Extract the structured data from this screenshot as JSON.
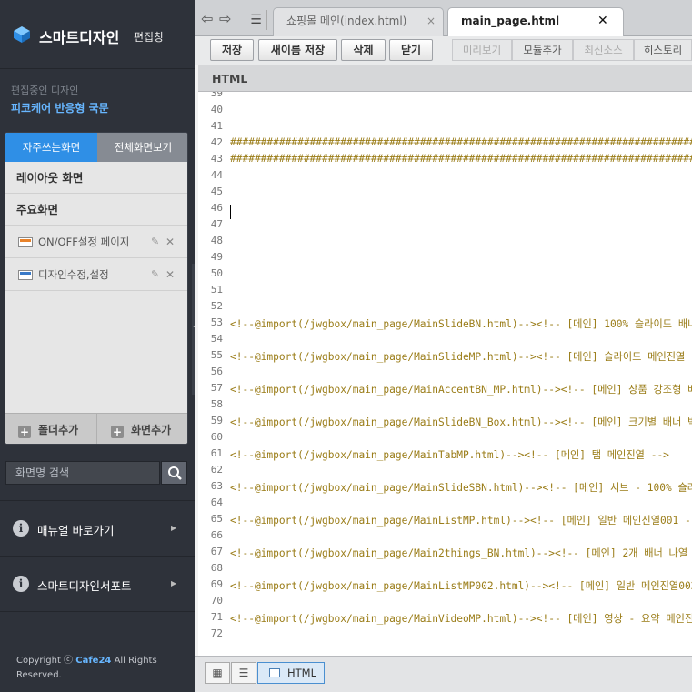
{
  "brand": {
    "title": "스마트디자인",
    "subtitle": "편집창"
  },
  "current": {
    "label": "편집중인 디자인",
    "name": "피코케어 반응형 국문"
  },
  "panel": {
    "tabs": [
      "자주쓰는화면",
      "전체화면보기"
    ],
    "sections": [
      "레이아웃 화면",
      "주요화면"
    ],
    "items": [
      {
        "label": "ON/OFF설정 페이지",
        "icon": "page-on-icon"
      },
      {
        "label": "디자인수정,설정",
        "icon": "page-design-icon"
      }
    ],
    "footer": {
      "add_folder": "폴더추가",
      "add_screen": "화면추가"
    }
  },
  "search": {
    "placeholder": "화면명 검색"
  },
  "links": [
    {
      "label": "매뉴얼 바로가기"
    },
    {
      "label": "스마트디자인서포트"
    }
  ],
  "copyright": {
    "prefix": "Copyright ⓒ",
    "brand": "Cafe24",
    "suffix": "All Rights Reserved."
  },
  "file_tabs": [
    {
      "label": "쇼핑몰 메인(index.html)",
      "close": "×"
    },
    {
      "label": "main_page.html",
      "close": "✕"
    }
  ],
  "toolbar": {
    "save": "저장",
    "save_as": "새이름 저장",
    "delete": "삭제",
    "close": "닫기",
    "preview": "미리보기",
    "add_module": "모듈추가",
    "latest_source": "최신소스",
    "history": "히스토리"
  },
  "editor": {
    "language": "HTML"
  },
  "code_lines": [
    {
      "n": "39",
      "text": ""
    },
    {
      "n": "40",
      "text": ""
    },
    {
      "n": "41",
      "text": ""
    },
    {
      "n": "42",
      "text": "##################################################################################"
    },
    {
      "n": "43",
      "text": "##################################################################################"
    },
    {
      "n": "44",
      "text": ""
    },
    {
      "n": "45",
      "text": ""
    },
    {
      "n": "46",
      "text": ""
    },
    {
      "n": "47",
      "text": ""
    },
    {
      "n": "48",
      "text": ""
    },
    {
      "n": "49",
      "text": ""
    },
    {
      "n": "50",
      "text": ""
    },
    {
      "n": "51",
      "text": ""
    },
    {
      "n": "52",
      "text": ""
    },
    {
      "n": "53",
      "text": "<!--@import(/jwgbox/main_page/MainSlideBN.html)--><!-- [메인] 100% 슬라이드 배너"
    },
    {
      "n": "54",
      "text": ""
    },
    {
      "n": "55",
      "text": "<!--@import(/jwgbox/main_page/MainSlideMP.html)--><!-- [메인] 슬라이드 메인진열"
    },
    {
      "n": "56",
      "text": ""
    },
    {
      "n": "57",
      "text": "<!--@import(/jwgbox/main_page/MainAccentBN_MP.html)--><!-- [메인] 상품 강조형 배"
    },
    {
      "n": "58",
      "text": ""
    },
    {
      "n": "59",
      "text": "<!--@import(/jwgbox/main_page/MainSlideBN_Box.html)--><!-- [메인] 크기별 배너 박"
    },
    {
      "n": "60",
      "text": ""
    },
    {
      "n": "61",
      "text": "<!--@import(/jwgbox/main_page/MainTabMP.html)--><!-- [메인] 탭 메인진열 -->"
    },
    {
      "n": "62",
      "text": ""
    },
    {
      "n": "63",
      "text": "<!--@import(/jwgbox/main_page/MainSlideSBN.html)--><!-- [메인] 서브 - 100% 슬라이"
    },
    {
      "n": "64",
      "text": ""
    },
    {
      "n": "65",
      "text": "<!--@import(/jwgbox/main_page/MainListMP.html)--><!-- [메인] 일반 메인진열001 --"
    },
    {
      "n": "66",
      "text": ""
    },
    {
      "n": "67",
      "text": "<!--@import(/jwgbox/main_page/Main2things_BN.html)--><!-- [메인] 2개 배너 나열 -"
    },
    {
      "n": "68",
      "text": ""
    },
    {
      "n": "69",
      "text": "<!--@import(/jwgbox/main_page/MainListMP002.html)--><!-- [메인] 일반 메인진열002"
    },
    {
      "n": "70",
      "text": ""
    },
    {
      "n": "71",
      "text": "<!--@import(/jwgbox/main_page/MainVideoMP.html)--><!-- [메인] 영상 - 요약 메인진"
    },
    {
      "n": "72",
      "text": ""
    }
  ],
  "view_modes": {
    "html": "HTML"
  },
  "colors": {
    "accent": "#2f8fe6",
    "link": "#67b6ff",
    "code": "#9a7c17",
    "sidebar": "#2e323a"
  }
}
